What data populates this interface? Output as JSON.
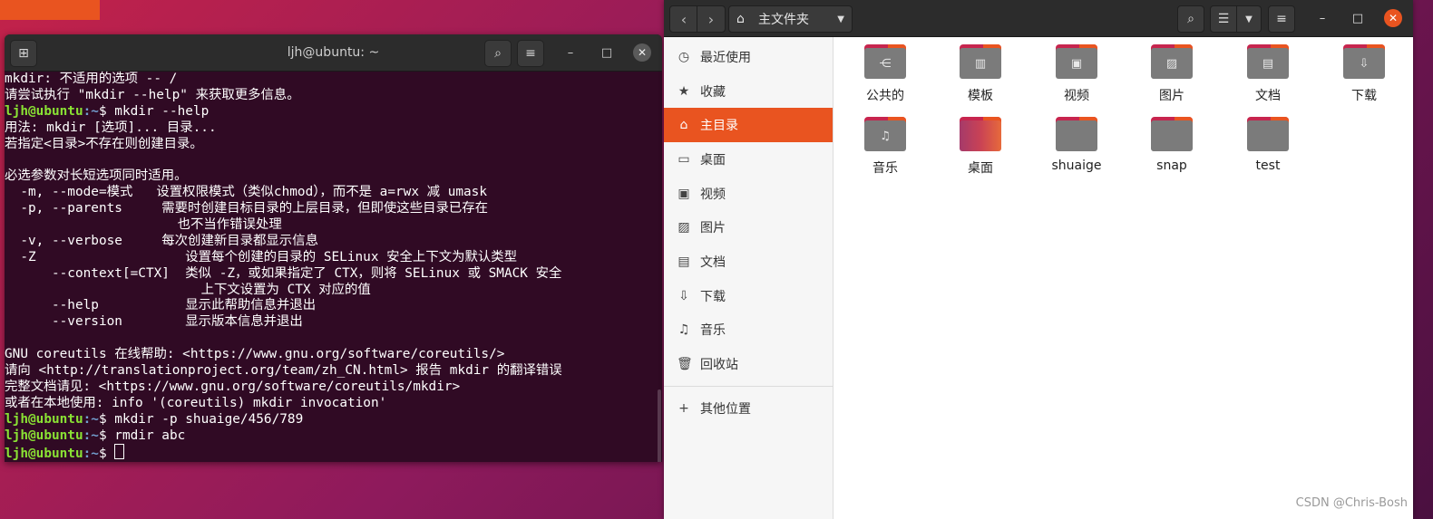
{
  "terminal": {
    "title": "ljh@ubuntu: ~",
    "lines": [
      {
        "text": "mkdir: 不适用的选项 -- /"
      },
      {
        "text": "请尝试执行 \"mkdir --help\" 来获取更多信息。"
      },
      {
        "prompt": true,
        "user": "ljh@ubuntu",
        "path": ":~",
        "sym": "$ ",
        "cmd": "mkdir --help"
      },
      {
        "text": "用法: mkdir [选项]... 目录..."
      },
      {
        "text": "若指定<目录>不存在则创建目录。"
      },
      {
        "text": ""
      },
      {
        "text": "必选参数对长短选项同时适用。"
      },
      {
        "text": "  -m, --mode=模式   设置权限模式（类似chmod），而不是 a=rwx 减 umask"
      },
      {
        "text": "  -p, --parents     需要时创建目标目录的上层目录，但即使这些目录已存在"
      },
      {
        "text": "                      也不当作错误处理"
      },
      {
        "text": "  -v, --verbose     每次创建新目录都显示信息"
      },
      {
        "text": "  -Z                   设置每个创建的目录的 SELinux 安全上下文为默认类型"
      },
      {
        "text": "      --context[=CTX]  类似 -Z，或如果指定了 CTX，则将 SELinux 或 SMACK 安全"
      },
      {
        "text": "                         上下文设置为 CTX 对应的值"
      },
      {
        "text": "      --help           显示此帮助信息并退出"
      },
      {
        "text": "      --version        显示版本信息并退出"
      },
      {
        "text": ""
      },
      {
        "text": "GNU coreutils 在线帮助: <https://www.gnu.org/software/coreutils/>"
      },
      {
        "text": "请向 <http://translationproject.org/team/zh_CN.html> 报告 mkdir 的翻译错误"
      },
      {
        "text": "完整文档请见: <https://www.gnu.org/software/coreutils/mkdir>"
      },
      {
        "text": "或者在本地使用: info '(coreutils) mkdir invocation'"
      },
      {
        "prompt": true,
        "user": "ljh@ubuntu",
        "path": ":~",
        "sym": "$ ",
        "cmd": "mkdir -p shuaige/456/789"
      },
      {
        "prompt": true,
        "user": "ljh@ubuntu",
        "path": ":~",
        "sym": "$ ",
        "cmd": "rmdir abc"
      },
      {
        "prompt": true,
        "user": "ljh@ubuntu",
        "path": ":~",
        "sym": "$ ",
        "cmd": "",
        "cursor": true
      }
    ]
  },
  "files": {
    "location": "主文件夹",
    "sidebar": [
      {
        "icon": "recent-icon",
        "glyph": "◷",
        "label": "最近使用"
      },
      {
        "icon": "star-icon",
        "glyph": "★",
        "label": "收藏"
      },
      {
        "icon": "home-icon",
        "glyph": "⌂",
        "label": "主目录",
        "active": true
      },
      {
        "icon": "desktop-icon",
        "glyph": "▭",
        "label": "桌面"
      },
      {
        "icon": "video-icon",
        "glyph": "▣",
        "label": "视频"
      },
      {
        "icon": "picture-icon",
        "glyph": "▨",
        "label": "图片"
      },
      {
        "icon": "document-icon",
        "glyph": "▤",
        "label": "文档"
      },
      {
        "icon": "download-icon",
        "glyph": "⇩",
        "label": "下载"
      },
      {
        "icon": "music-icon",
        "glyph": "♫",
        "label": "音乐"
      },
      {
        "icon": "trash-icon",
        "glyph": "🗑",
        "label": "回收站"
      }
    ],
    "other_locations": {
      "icon": "plus-icon",
      "glyph": "+",
      "label": "其他位置"
    },
    "items": [
      {
        "name": "公共的",
        "icon": "share-icon",
        "glyph": "⋲"
      },
      {
        "name": "模板",
        "icon": "template-icon",
        "glyph": "▥"
      },
      {
        "name": "视频",
        "icon": "video-icon",
        "glyph": "▣"
      },
      {
        "name": "图片",
        "icon": "picture-icon",
        "glyph": "▨"
      },
      {
        "name": "文档",
        "icon": "document-icon",
        "glyph": "▤"
      },
      {
        "name": "下载",
        "icon": "download-icon",
        "glyph": "⇩"
      },
      {
        "name": "音乐",
        "icon": "music-icon",
        "glyph": "♫"
      },
      {
        "name": "桌面",
        "icon": "desktop-folder-icon",
        "glyph": "",
        "desktop": true
      },
      {
        "name": "shuaige",
        "icon": "folder-icon",
        "glyph": ""
      },
      {
        "name": "snap",
        "icon": "folder-icon",
        "glyph": ""
      },
      {
        "name": "test",
        "icon": "folder-icon",
        "glyph": ""
      }
    ]
  },
  "watermark": "CSDN @Chris-Bosh",
  "colors": {
    "accent": "#e95420",
    "terminal_bg": "#300a24",
    "prompt_user": "#8ae234",
    "prompt_path": "#729fcf"
  }
}
